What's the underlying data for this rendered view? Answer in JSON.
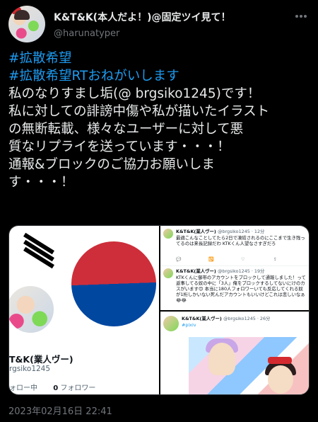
{
  "author": {
    "display_name": "K&T&K(本人だよ！)@固定ツイ見て！",
    "handle": "@harunatyper"
  },
  "icons": {
    "more": "more-dots-icon",
    "avatar": "user-avatar"
  },
  "tweet": {
    "hashtag1": "#拡散希望",
    "hashtag2": "#拡散希望RTおねがいします",
    "lines": [
      "私のなりすまし垢(@ brgsiko1245)です！",
      "私に対しての誹謗中傷や私が描いたイラスト",
      "の無断転載、様々なユーザーに対して悪",
      "質なリプライを送っています・・・！",
      "通報&ブロックのご協力お願いしま",
      "す・・・！"
    ],
    "timestamp": "2023年02月16日 22:41"
  },
  "media": {
    "profile": {
      "name": "T&K(業人ヴー)",
      "handle": "rgsiko1245",
      "following_label": "ォロー中",
      "followers_count": "0",
      "followers_label": "フォロワー"
    },
    "reply1": {
      "name": "K&T&K(業人ヴー)",
      "meta": "@brgsiko1245 · 12分",
      "body": "最適こんなことしてたら2日で凍結されるのにここまで生き残ってるのは来長記録だわ KTKくん人望なさすぎだろ"
    },
    "reply2": {
      "name": "K&T&K(業人ヴー)",
      "meta": "@brgsiko1245 · 19分",
      "body": "KTKくんに御帯のアカウントをブロックして通報しました！って返事してる奴の中に「3人」俺をブロックするしてないにけのカスがいます😊 本当に180人フォロワーいても反応してくれる奴が1桁しかいない死んだアカウントもいいけどこれは悲しいなぁ😂😂"
    },
    "reply3": {
      "name": "K&T&K(業人ヴー)",
      "meta": "@brgsiko1245 · 26分",
      "tag": "#pixiv"
    }
  }
}
